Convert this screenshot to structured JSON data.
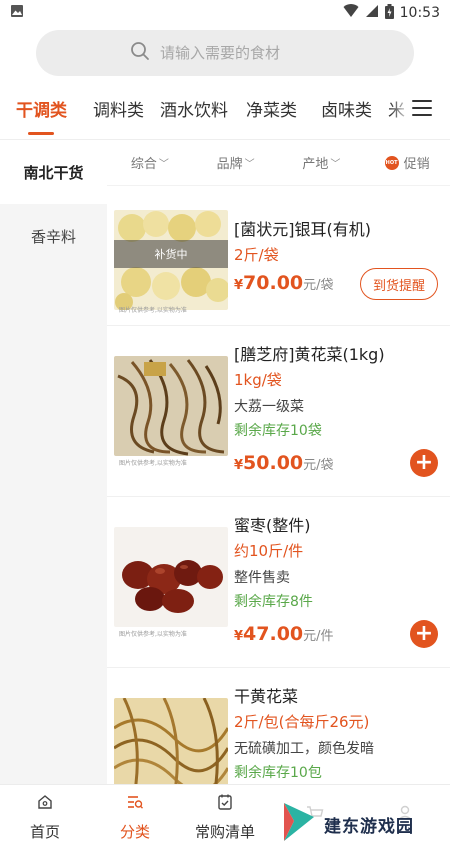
{
  "status_bar": {
    "time": "10:53"
  },
  "search": {
    "placeholder": "请输入需要的食材"
  },
  "category_tabs": [
    {
      "label": "干调类",
      "active": true
    },
    {
      "label": "调料类",
      "active": false
    },
    {
      "label": "酒水饮料",
      "active": false
    },
    {
      "label": "净菜类",
      "active": false
    },
    {
      "label": "卤味类",
      "active": false
    },
    {
      "label": "米",
      "active": false
    }
  ],
  "sidebar": {
    "items": [
      {
        "label": "南北干货",
        "active": true
      },
      {
        "label": "香辛料",
        "active": false
      }
    ]
  },
  "filters": {
    "items": [
      {
        "label": "综合",
        "caret": "﹀"
      },
      {
        "label": "品牌",
        "caret": "﹀"
      },
      {
        "label": "产地",
        "caret": "﹀"
      }
    ],
    "promo": {
      "badge": "HOT",
      "label": "促销"
    }
  },
  "products": [
    {
      "title": "[菌状元]银耳(有机)",
      "spec": "2斤/袋",
      "price_symbol": "¥",
      "price": "70.00",
      "unit": "元/袋",
      "image_note": "图片仅供参考,以实物为准",
      "overlay": "补货中",
      "action_label": "到货提醒"
    },
    {
      "title": "[膳芝府]黄花菜(1kg)",
      "spec": "1kg/袋",
      "desc": "大荔一级菜",
      "stock": "剩余库存10袋",
      "price_symbol": "¥",
      "price": "50.00",
      "unit": "元/袋",
      "image_note": "图片仅供参考,以实物为准",
      "add_symbol": "+"
    },
    {
      "title": "蜜枣(整件)",
      "spec": "约10斤/件",
      "desc": "整件售卖",
      "stock": "剩余库存8件",
      "price_symbol": "¥",
      "price": "47.00",
      "unit": "元/件",
      "image_note": "图片仅供参考,以实物为准",
      "add_symbol": "+"
    },
    {
      "title": "干黄花菜",
      "spec": "2斤/包(合每斤26元)",
      "desc": "无硫磺加工，颜色发暗",
      "stock": "剩余库存10包"
    }
  ],
  "bottom_nav": {
    "items": [
      {
        "label": "首页",
        "icon": "home-icon",
        "active": false
      },
      {
        "label": "分类",
        "icon": "category-icon",
        "active": true
      },
      {
        "label": "常购清单",
        "icon": "list-icon",
        "active": false
      },
      {
        "label": "",
        "icon": "cart-icon",
        "active": false
      },
      {
        "label": "",
        "icon": "profile-icon",
        "active": false
      }
    ]
  },
  "watermark": {
    "text": "建东游戏园"
  },
  "colors": {
    "accent": "#e2541f",
    "stock_green": "#5aa84a",
    "sidebar_bg": "#f5f5f5"
  }
}
